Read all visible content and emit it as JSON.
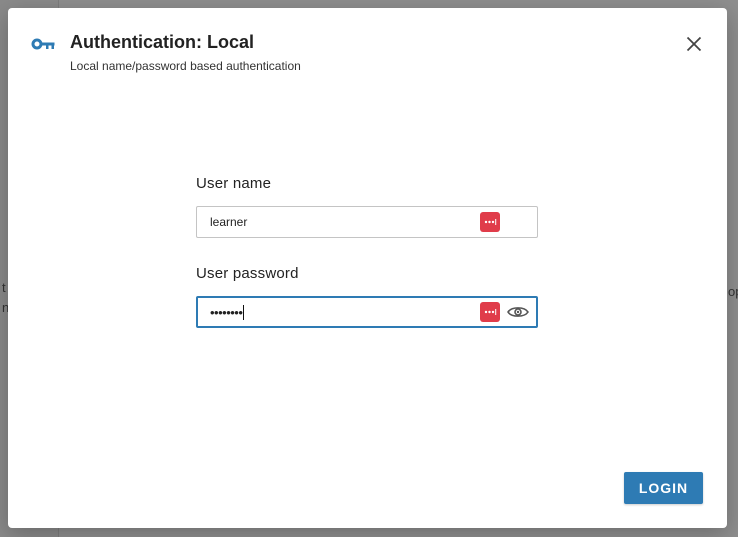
{
  "background": {
    "left_fragment": "t\nn",
    "right_fragment": "op"
  },
  "dialog": {
    "icon": "key-icon",
    "title": "Authentication: Local",
    "subtitle": "Local name/password based authentication",
    "close_icon": "close-icon"
  },
  "form": {
    "username": {
      "label": "User name",
      "value": "learner",
      "password_manager_icon": "password-manager-icon"
    },
    "password": {
      "label": "User password",
      "masked_value": "••••••••",
      "password_manager_icon": "password-manager-icon",
      "reveal_icon": "eye-icon"
    }
  },
  "actions": {
    "login_label": "LOGIN"
  },
  "colors": {
    "accent": "#2e7bb4",
    "password_manager": "#e03c4a",
    "backdrop": "#8f8f8f"
  }
}
